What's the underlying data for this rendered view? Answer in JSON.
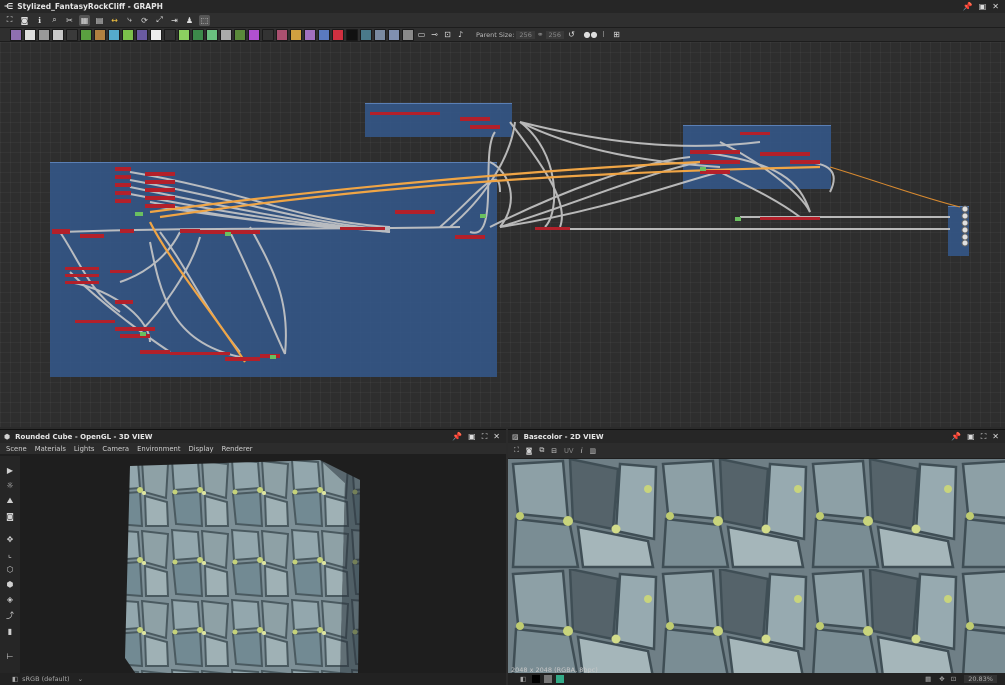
{
  "graph_window": {
    "title": "Stylized_FantasyRockCliff - GRAPH",
    "parent_size_label": "Parent Size:",
    "parent_size_w": "256",
    "parent_size_h": "256"
  },
  "view3d": {
    "title": "Rounded Cube - OpenGL - 3D VIEW",
    "menus": [
      "Scene",
      "Materials",
      "Lights",
      "Camera",
      "Environment",
      "Display",
      "Renderer"
    ],
    "colorspace": "sRGB (default)"
  },
  "view2d": {
    "title": "Basecolor - 2D VIEW",
    "uv_label": "UV",
    "info_text": "2048 x 2048 (RGBA, 8bpc)",
    "zoom": "20.83%"
  },
  "colors": {
    "frame_blue": "#34588a",
    "link_gray": "#c8c8c8",
    "link_orange": "#f0a545",
    "node_red": "#b3202a"
  }
}
